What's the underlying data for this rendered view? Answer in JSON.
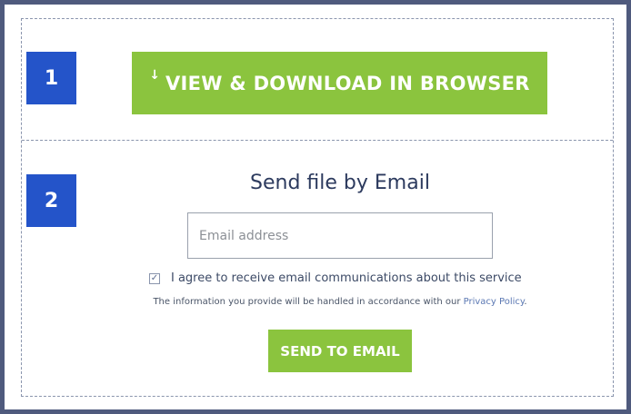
{
  "step1": {
    "number": "1",
    "download_icon": "↓",
    "download_label": "VIEW & DOWNLOAD IN BROWSER"
  },
  "step2": {
    "number": "2",
    "title": "Send file by Email",
    "email_placeholder": "Email address",
    "email_value": "",
    "consent_checked": true,
    "consent_check_glyph": "✓",
    "consent_text": "I agree to receive email communications about this service",
    "privacy_prefix": "The information you provide will be handled in accordance with our ",
    "privacy_link": "Privacy Policy",
    "privacy_suffix": ".",
    "send_label": "SEND TO EMAIL"
  },
  "colors": {
    "accent_green": "#8bc43e",
    "badge_blue": "#2454c9",
    "frame": "#4f5a7d",
    "title_text": "#2c3a5e"
  },
  "icons": {
    "download": "download-arrow-icon",
    "check": "checkmark-icon"
  }
}
